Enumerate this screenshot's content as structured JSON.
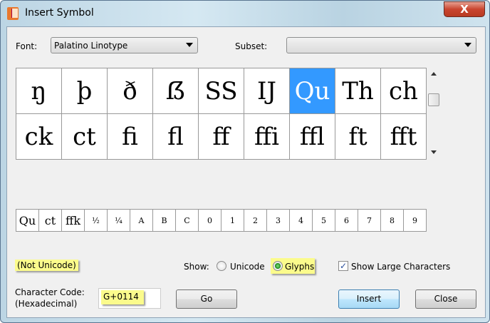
{
  "window": {
    "title": "Insert Symbol",
    "close_label": "X"
  },
  "font": {
    "label": "Font:",
    "value": "Palatino Linotype"
  },
  "subset": {
    "label": "Subset:",
    "value": ""
  },
  "grid": [
    "ŋ",
    "þ",
    "ð",
    "ẞ",
    "SS",
    "IJ",
    "Qu",
    "Th",
    "ch",
    "ck",
    "ct",
    "fi",
    "fl",
    "ff",
    "ffi",
    "ffl",
    "ft",
    "fft"
  ],
  "selected_index": 6,
  "recent": [
    "Qu",
    "ct",
    "ffk",
    "½",
    "¼",
    "A",
    "B",
    "C",
    "0",
    "1",
    "2",
    "3",
    "4",
    "5",
    "6",
    "7",
    "8",
    "9"
  ],
  "status": "(Not Unicode)",
  "show": {
    "label": "Show:",
    "unicode": "Unicode",
    "glyphs": "Glyphs",
    "selected": "Glyphs"
  },
  "large_chars": {
    "label": "Show Large Characters",
    "checked": true
  },
  "char_code": {
    "label1": "Character Code:",
    "label2": "(Hexadecimal)",
    "value": "G+0114"
  },
  "buttons": {
    "go": "Go",
    "insert": "Insert",
    "close": "Close"
  }
}
